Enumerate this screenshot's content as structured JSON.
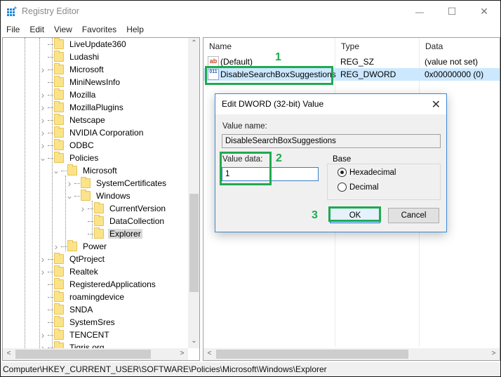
{
  "window": {
    "title": "Registry Editor",
    "controls": {
      "minimize": "—",
      "maximize": "☐",
      "close": "✕"
    }
  },
  "menu": [
    "File",
    "Edit",
    "View",
    "Favorites",
    "Help"
  ],
  "tree": {
    "items": [
      {
        "label": "LiveUpdate360",
        "level": 0,
        "expander": "none"
      },
      {
        "label": "Ludashi",
        "level": 0,
        "expander": "none"
      },
      {
        "label": "Microsoft",
        "level": 0,
        "expander": "collapsed"
      },
      {
        "label": "MiniNewsInfo",
        "level": 0,
        "expander": "none"
      },
      {
        "label": "Mozilla",
        "level": 0,
        "expander": "collapsed"
      },
      {
        "label": "MozillaPlugins",
        "level": 0,
        "expander": "collapsed"
      },
      {
        "label": "Netscape",
        "level": 0,
        "expander": "collapsed"
      },
      {
        "label": "NVIDIA Corporation",
        "level": 0,
        "expander": "collapsed"
      },
      {
        "label": "ODBC",
        "level": 0,
        "expander": "collapsed"
      },
      {
        "label": "Policies",
        "level": 0,
        "expander": "expanded"
      },
      {
        "label": "Microsoft",
        "level": 1,
        "expander": "expanded"
      },
      {
        "label": "SystemCertificates",
        "level": 2,
        "expander": "collapsed"
      },
      {
        "label": "Windows",
        "level": 2,
        "expander": "expanded"
      },
      {
        "label": "CurrentVersion",
        "level": 3,
        "expander": "collapsed"
      },
      {
        "label": "DataCollection",
        "level": 3,
        "expander": "none"
      },
      {
        "label": "Explorer",
        "level": 3,
        "expander": "none",
        "selected": true
      },
      {
        "label": "Power",
        "level": 1,
        "expander": "collapsed"
      },
      {
        "label": "QtProject",
        "level": 0,
        "expander": "collapsed"
      },
      {
        "label": "Realtek",
        "level": 0,
        "expander": "collapsed"
      },
      {
        "label": "RegisteredApplications",
        "level": 0,
        "expander": "none"
      },
      {
        "label": "roamingdevice",
        "level": 0,
        "expander": "none"
      },
      {
        "label": "SNDA",
        "level": 0,
        "expander": "none"
      },
      {
        "label": "SystemSres",
        "level": 0,
        "expander": "none"
      },
      {
        "label": "TENCENT",
        "level": 0,
        "expander": "collapsed"
      },
      {
        "label": "Tigris.org",
        "level": 0,
        "expander": "collapsed"
      }
    ]
  },
  "list": {
    "columns": [
      "Name",
      "Type",
      "Data"
    ],
    "rows": [
      {
        "icon": "string-value-icon",
        "icon_text": "ab",
        "name": "(Default)",
        "type": "REG_SZ",
        "data": "(value not set)",
        "selected": false
      },
      {
        "icon": "dword-value-icon",
        "icon_text": "011",
        "name": "DisableSearchBoxSuggestions",
        "type": "REG_DWORD",
        "data": "0x00000000 (0)",
        "selected": true
      }
    ]
  },
  "dialog": {
    "title": "Edit DWORD (32-bit) Value",
    "value_name_label": "Value name:",
    "value_name": "DisableSearchBoxSuggestions",
    "value_data_label": "Value data:",
    "value_data": "1",
    "base_label": "Base",
    "base_options": [
      {
        "label": "Hexadecimal",
        "checked": true
      },
      {
        "label": "Decimal",
        "checked": false
      }
    ],
    "ok_label": "OK",
    "cancel_label": "Cancel"
  },
  "annotations": {
    "step1": "1",
    "step2": "2",
    "step3": "3",
    "color": "#1faa4f"
  },
  "statusbar": {
    "path": "Computer\\HKEY_CURRENT_USER\\SOFTWARE\\Policies\\Microsoft\\Windows\\Explorer"
  }
}
